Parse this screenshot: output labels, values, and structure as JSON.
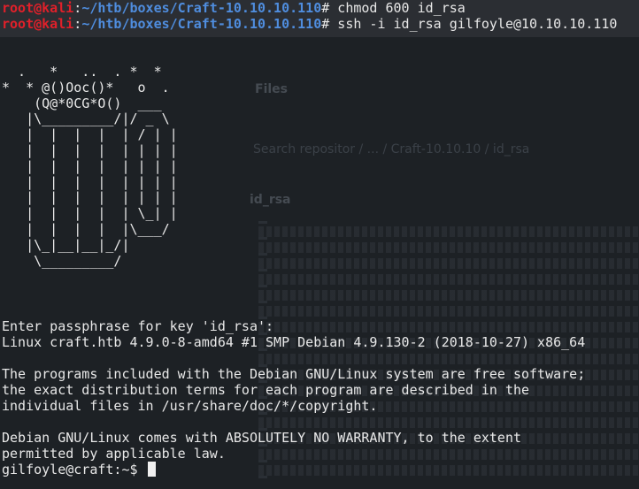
{
  "background_window": {
    "title": "Files",
    "search_text": "Search repositor / ... / Craft-10.10.10 / id_rsa",
    "file_name": "id_rsa"
  },
  "header": {
    "prompt1": {
      "user": "root",
      "at": "@",
      "host": "kali",
      "sep": ":",
      "path": "~/htb/boxes/Craft-10.10.10.110",
      "symbol": "#",
      "command": " chmod 600 id_rsa"
    },
    "prompt2": {
      "user": "root",
      "at": "@",
      "host": "kali",
      "sep": ":",
      "path": "~/htb/boxes/Craft-10.10.10.110",
      "symbol": "#",
      "command": " ssh -i id_rsa gilfoyle@10.10.10.110"
    }
  },
  "ascii_art": [
    "  .   *   ..  . *  *",
    "*  * @()Ooc()*   o  .",
    "    (Q@*0CG*O()  ___",
    "   |\\_________/|/ _ \\",
    "   |  |  |  |  | / | |",
    "   |  |  |  |  | | | |",
    "   |  |  |  |  | | | |",
    "   |  |  |  |  | | | |",
    "   |  |  |  |  | | | |",
    "   |  |  |  |  | \\_| |",
    "   |  |  |  |  |\\___/",
    "   |\\_|__|__|_/|",
    "    \\_________/"
  ],
  "output": {
    "passphrase": "Enter passphrase for key 'id_rsa':",
    "uname": "Linux craft.htb 4.9.0-8-amd64 #1 SMP Debian 4.9.130-2 (2018-10-27) x86_64",
    "blank1": "",
    "motd1": "The programs included with the Debian GNU/Linux system are free software;",
    "motd2": "the exact distribution terms for each program are described in the",
    "motd3": "individual files in /usr/share/doc/*/copyright.",
    "blank2": "",
    "warranty1": "Debian GNU/Linux comes with ABSOLUTELY NO WARRANTY, to the extent",
    "warranty2": "permitted by applicable law.",
    "final_prompt": "gilfoyle@craft:~$ "
  }
}
